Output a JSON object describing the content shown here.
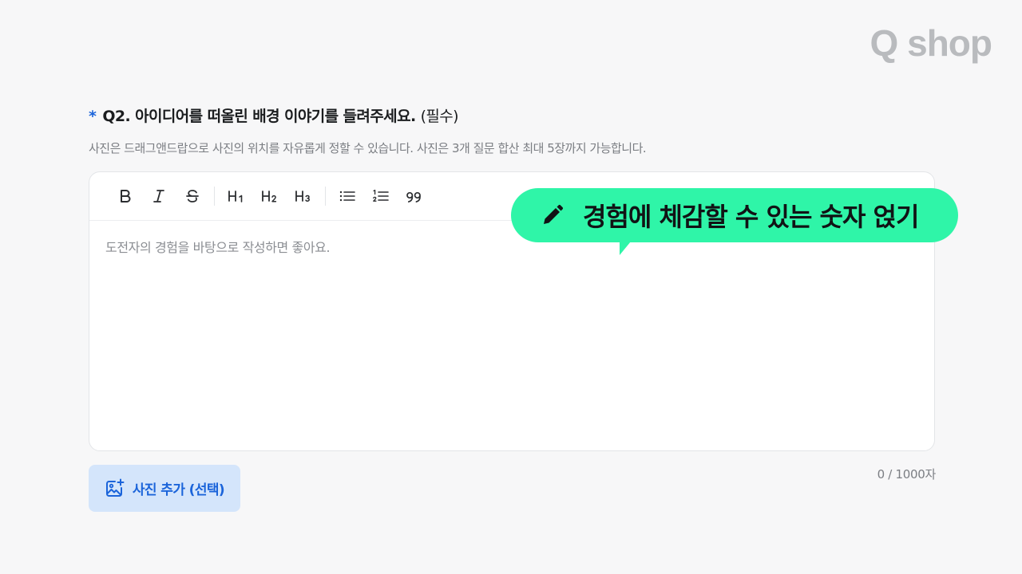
{
  "brand": {
    "logo_text": "Q shop"
  },
  "question": {
    "required_mark": "*",
    "title": "Q2. 아이디어를 떠올린 배경 이야기를 들려주세요.",
    "required_label": "(필수)",
    "helper": "사진은 드래그앤드랍으로 사진의 위치를 자유롭게 정할 수 있습니다. 사진은 3개 질문 합산 최대 5장까지 가능합니다."
  },
  "toolbar": {
    "buttons": [
      {
        "name": "bold",
        "icon": "bold-icon"
      },
      {
        "name": "italic",
        "icon": "italic-icon"
      },
      {
        "name": "strikethrough",
        "icon": "strikethrough-icon"
      },
      {
        "name": "heading-1",
        "icon": "heading1-icon"
      },
      {
        "name": "heading-2",
        "icon": "heading2-icon"
      },
      {
        "name": "heading-3",
        "icon": "heading3-icon"
      },
      {
        "name": "bullet-list",
        "icon": "bullet-list-icon"
      },
      {
        "name": "numbered-list",
        "icon": "numbered-list-icon"
      },
      {
        "name": "quote",
        "icon": "quote-icon"
      }
    ]
  },
  "editor": {
    "placeholder": "도전자의 경험을 바탕으로 작성하면 좋아요.",
    "counter": "0 / 1000자"
  },
  "tooltip": {
    "icon": "pencil-icon",
    "text": "경험에 체감할 수 있는 숫자 얹기",
    "color": "#2ff5a8"
  },
  "photo_button": {
    "icon": "add-image-icon",
    "label": "사진 추가 (선택)",
    "color": "#1b64da"
  }
}
